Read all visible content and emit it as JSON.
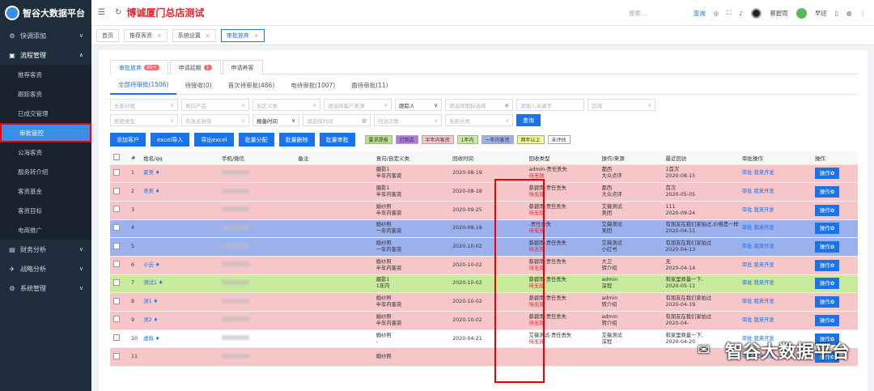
{
  "app": {
    "logo": "智谷大数据平台",
    "title": "博诚厦门总店测试"
  },
  "header": {
    "search_placeholder": "搜索...",
    "query": "查询",
    "user_name": "蔡碧雨",
    "shift": "早班"
  },
  "sidebar": {
    "items": [
      {
        "label": "快调添加",
        "icon": "gear-icon",
        "chev": "∨"
      },
      {
        "label": "流程管理",
        "icon": "briefcase-icon",
        "chev": "∧",
        "open": true
      },
      {
        "label": "财务分析",
        "icon": "chart-icon",
        "chev": "∨"
      },
      {
        "label": "战略分析",
        "icon": "plane-icon",
        "chev": "∨"
      },
      {
        "label": "系统管理",
        "icon": "gear-icon",
        "chev": "∨"
      }
    ],
    "sub_items": [
      "推荐客资",
      "跟踪客资",
      "已成交管理",
      "审批管控",
      "公海客资",
      "服务转介绍",
      "客资基金",
      "客资目标",
      "电商推广"
    ],
    "active_sub": "审批管控"
  },
  "tags": [
    {
      "label": "首页"
    },
    {
      "label": "推荐客资"
    },
    {
      "label": "系统设置"
    },
    {
      "label": "审批放弃",
      "active": true
    }
  ],
  "top_tabs": [
    {
      "label": "审批放弃",
      "badge": "99+",
      "active": true
    },
    {
      "label": "申请延期",
      "badge": "1"
    },
    {
      "label": "申请养客",
      "badge": ""
    }
  ],
  "sub_tabs": [
    "全部待审批(1506)",
    "待接收(0)",
    "首次待审批(486)",
    "电待审批(1007)",
    "面待审批(11)"
  ],
  "filters": {
    "row1": [
      "全部分组",
      "意向产品",
      "自定义类",
      "请选择客户来源",
      "跟踪人",
      "请选择图标选择",
      "请输入关键字"
    ],
    "row2": [
      "区域",
      "拒绝类型",
      "有效无效带",
      "报备时间",
      "请选择时间",
      "回访次数",
      "系统分类"
    ],
    "search_button": "查询"
  },
  "actions": [
    "添加客户",
    "excel导入",
    "导出excel",
    "批量分配",
    "批量删除",
    "批量审批"
  ],
  "legend": [
    {
      "label": "要求提报",
      "color": "#b6e28a"
    },
    {
      "label": "已到店",
      "color": "#b07ae0"
    },
    {
      "label": "半年内客资",
      "color": "#f7c6c9"
    },
    {
      "label": "1年内",
      "color": "#c8ea9c"
    },
    {
      "label": "一年内客资",
      "color": "#9db0ee"
    },
    {
      "label": "两年以上",
      "color": "#f5f59a"
    },
    {
      "label": "未评估",
      "color": "#ffffff"
    }
  ],
  "table": {
    "columns": [
      "#",
      "姓名/qq",
      "手机/微信",
      "备注",
      "意向/自定义类",
      "回收时间",
      "回收类型",
      "操作/来源",
      "最近回访",
      "审批操作",
      "操作"
    ],
    "rows": [
      {
        "n": "1",
        "name": "夏美",
        "intent1": "摄影1",
        "intent2": "半年内客资",
        "time": "2020-08-19",
        "type1": "admin-责任丢失",
        "type2": "待无效",
        "src1": "都西",
        "src2": "大众点评",
        "visit1": "1首次",
        "visit2": "2020-08-15",
        "color": "pink"
      },
      {
        "n": "2",
        "name": "美美",
        "intent1": "摄影1",
        "intent2": "半年内客资",
        "time": "2020-08-18",
        "type1": "蔡碧雨-责任丢失",
        "type2": "待无效",
        "src1": "都西",
        "src2": "大众点评",
        "visit1": "首次",
        "visit2": "2020-05-05",
        "color": "pink"
      },
      {
        "n": "3",
        "name": "",
        "intent1": "婚纱照",
        "intent2": "半年内客资",
        "time": "2020-09-25",
        "type1": "蔡碧雨-责任丢失",
        "type2": "待无效",
        "src1": "艾薇测试",
        "src2": "美团",
        "visit1": "111",
        "visit2": "2020-09-24",
        "color": "pink"
      },
      {
        "n": "4",
        "name": "",
        "intent1": "婚纱照",
        "intent2": "一年内客资",
        "time": "2020-08-18",
        "type1": "-责任丢失",
        "type2": "待无效",
        "src1": "艾薇测试",
        "src2": "美团",
        "visit1": "有朋友在我们家拍过,价格是一样",
        "visit2": "2020-04-11",
        "color": "blue"
      },
      {
        "n": "5",
        "name": "",
        "intent1": "婚纱照",
        "intent2": "一年内客资",
        "time": "2020-10-02",
        "type1": "蔡碧雨-责任丢失",
        "type2": "待无效",
        "src1": "艾薇测试",
        "src2": "小红书",
        "visit1": "有朋友在我们家拍过",
        "visit2": "2020-04-13",
        "color": "blue"
      },
      {
        "n": "6",
        "name": "小云",
        "intent1": "婚纱照",
        "intent2": "半年内客资",
        "time": "2020-10-02",
        "type1": "蔡碧雨-责任丢失",
        "type2": "待无效",
        "src1": "大卫",
        "src2": "转介绍",
        "visit1": "无",
        "visit2": "2020-04-14",
        "color": "pink"
      },
      {
        "n": "7",
        "name": "测试1",
        "intent1": "摄影1",
        "intent2": "1年内",
        "time": "2020-10-02",
        "type1": "蔡碧雨-责任丢失",
        "type2": "待无效",
        "src1": "admin",
        "src2": "深程",
        "visit1": "和家里商量一下,",
        "visit2": "2020-05-11",
        "color": "green"
      },
      {
        "n": "8",
        "name": "测1",
        "intent1": "婚纱照",
        "intent2": "半年内客资",
        "time": "2020-10-02",
        "type1": "蔡碧雨-责任丢失",
        "type2": "待无效",
        "src1": "admin",
        "src2": "转介绍",
        "visit1": "有朋友在我们家拍过",
        "visit2": "2020-04-19",
        "color": "pink"
      },
      {
        "n": "9",
        "name": "测2",
        "intent1": "婚纱照",
        "intent2": "半年内客资",
        "time": "2020-10-02",
        "type1": "蔡碧雨-责任丢失",
        "type2": "待无效",
        "src1": "admin",
        "src2": "转介绍",
        "visit1": "有朋友在我们家拍过",
        "visit2": "2020-04-",
        "color": "pink"
      },
      {
        "n": "10",
        "name": "虚拟",
        "intent1": "婚纱照",
        "intent2": "-",
        "time": "2020-04-21",
        "type1": "艾薇测试-责任丢失",
        "type2": "待无效",
        "src1": "艾薇测试",
        "src2": "深程",
        "visit1": "和家里商量一下,",
        "visit2": "2020-04-20",
        "color": "white"
      },
      {
        "n": "11",
        "name": "",
        "intent1": "婚纱照",
        "intent2": "",
        "time": "",
        "type1": "",
        "type2": "",
        "src1": "",
        "src2": "",
        "visit1": "",
        "visit2": "",
        "color": "pink"
      }
    ],
    "approve_link": "审批",
    "wish_link": "我来开发",
    "op_button": "操作✿"
  },
  "watermark": "智谷大数据平台"
}
